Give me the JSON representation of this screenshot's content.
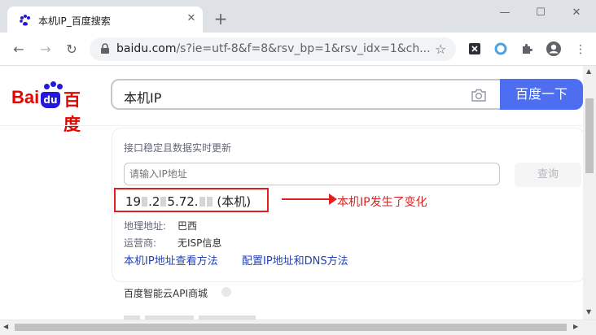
{
  "browser": {
    "tab_title": "本机IP_百度搜索",
    "tab_close": "✕",
    "new_tab": "+",
    "url_host": "baidu.com",
    "url_path": "/s?ie=utf-8&f=8&rsv_bp=1&rsv_idx=1&ch...",
    "window_minimize": "—",
    "window_maximize": "☐",
    "window_close": "✕"
  },
  "nav": {
    "back": "←",
    "forward": "→",
    "reload": "↻",
    "star": "☆"
  },
  "baidu": {
    "logo_latin_1": "Bai",
    "logo_badge": "du",
    "logo_cn": "百度",
    "search_query": "本机IP",
    "search_button": "百度一下"
  },
  "ip_card": {
    "hint": "接口稳定且数据实时更新",
    "input_placeholder": "请输入IP地址",
    "query_button": "查询",
    "ip_part1": "19",
    "ip_part2": ".2",
    "ip_part3": "5.72.",
    "ip_suffix": "(本机)",
    "location_label": "地理地址:",
    "location_value": "巴西",
    "isp_label": "运营商:",
    "isp_value": "无ISP信息",
    "link1": "本机IP地址查看方法",
    "link2": "配置IP地址和DNS方法"
  },
  "annotation": "本机IP发生了变化",
  "cloud_section": "百度智能云API商城",
  "colors": {
    "baidu_blue": "#4e6ef2",
    "baidu_red": "#e10601",
    "annotation_red": "#e02020",
    "link_blue": "#2440b3"
  }
}
